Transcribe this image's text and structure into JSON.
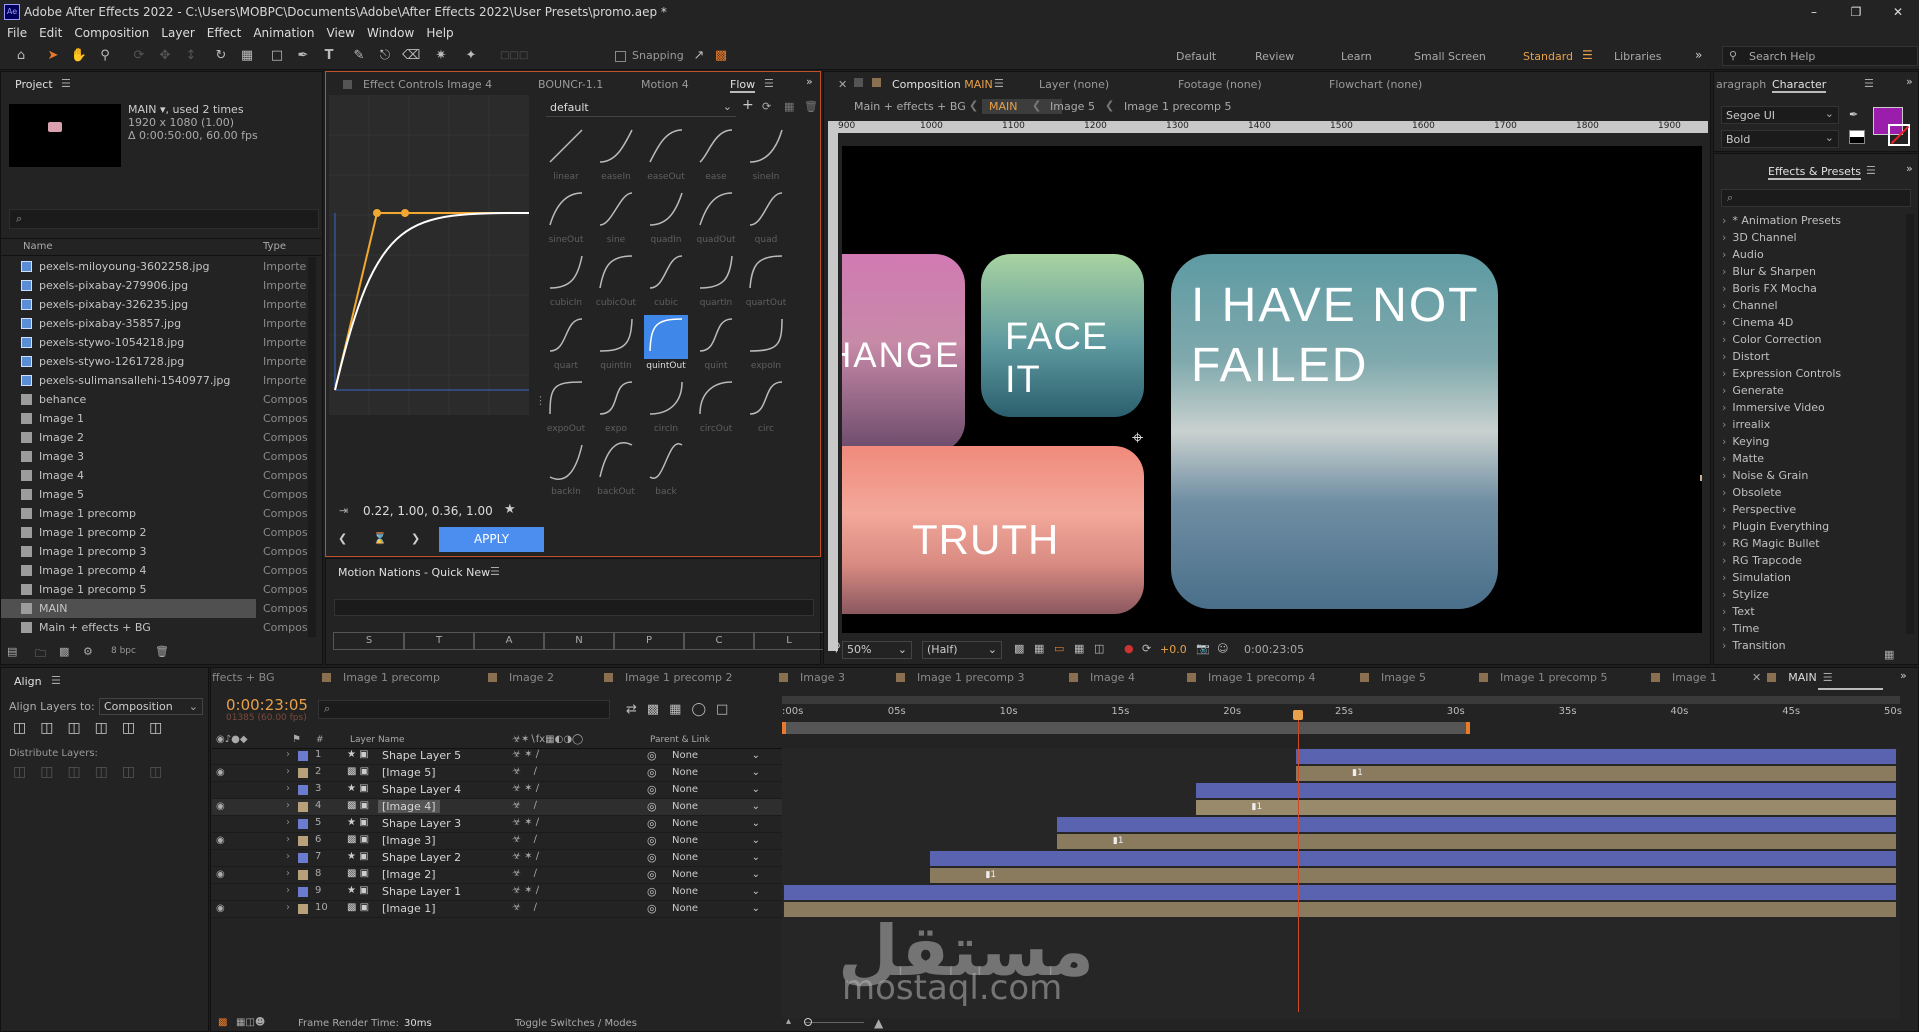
{
  "app": {
    "title": "Adobe After Effects 2022 - C:\\Users\\MOBPC\\Documents\\Adobe\\After Effects 2022\\User Presets\\promo.aep *",
    "logo": "Ae"
  },
  "menu": [
    "File",
    "Edit",
    "Composition",
    "Layer",
    "Effect",
    "Animation",
    "View",
    "Window",
    "Help"
  ],
  "toolbar": {
    "snapping_label": "Snapping",
    "workspaces": [
      "Default",
      "Review",
      "Learn",
      "Small Screen",
      "Standard",
      "Libraries"
    ],
    "active_workspace": "Standard",
    "search_help": "Search Help"
  },
  "project": {
    "tab": "Project",
    "comp_name": "MAIN",
    "used": ", used 2 times",
    "res": "1920 x 1080 (1.00)",
    "duration": "Δ 0:00:50:00, 60.00 fps",
    "search_placeholder": "⌕",
    "col_name": "Name",
    "col_type": "Type",
    "items": [
      {
        "name": "pexels-miloyoung-3602258.jpg",
        "type": "Importe",
        "kind": "file"
      },
      {
        "name": "pexels-pixabay-279906.jpg",
        "type": "Importe",
        "kind": "file"
      },
      {
        "name": "pexels-pixabay-326235.jpg",
        "type": "Importe",
        "kind": "file"
      },
      {
        "name": "pexels-pixabay-35857.jpg",
        "type": "Importe",
        "kind": "file"
      },
      {
        "name": "pexels-stywo-1054218.jpg",
        "type": "Importe",
        "kind": "file"
      },
      {
        "name": "pexels-stywo-1261728.jpg",
        "type": "Importe",
        "kind": "file"
      },
      {
        "name": "pexels-sulimansallehi-1540977.jpg",
        "type": "Importe",
        "kind": "file"
      },
      {
        "name": "behance",
        "type": "Compos",
        "kind": "comp"
      },
      {
        "name": "Image 1",
        "type": "Compos",
        "kind": "comp"
      },
      {
        "name": "Image 2",
        "type": "Compos",
        "kind": "comp"
      },
      {
        "name": "Image 3",
        "type": "Compos",
        "kind": "comp"
      },
      {
        "name": "Image 4",
        "type": "Compos",
        "kind": "comp"
      },
      {
        "name": "Image 5",
        "type": "Compos",
        "kind": "comp"
      },
      {
        "name": "Image 1 precomp",
        "type": "Compos",
        "kind": "comp"
      },
      {
        "name": "Image 1 precomp 2",
        "type": "Compos",
        "kind": "comp"
      },
      {
        "name": "Image 1 precomp 3",
        "type": "Compos",
        "kind": "comp"
      },
      {
        "name": "Image 1 precomp 4",
        "type": "Compos",
        "kind": "comp"
      },
      {
        "name": "Image 1 precomp 5",
        "type": "Compos",
        "kind": "comp"
      },
      {
        "name": "MAIN",
        "type": "Compos",
        "kind": "comp",
        "selected": true
      },
      {
        "name": "Main + effects + BG",
        "type": "Compos",
        "kind": "comp"
      }
    ],
    "bpc": "8 bpc"
  },
  "effect_controls": {
    "tabs": [
      "Effect Controls Image 4",
      "BOUNCr-1.1",
      "Motion 4",
      "Flow"
    ],
    "active_tab": "Flow",
    "preset_dropdown": "default",
    "bezier_values": "0.22, 1.00, 0.36, 1.00",
    "apply_label": "APPLY",
    "presets": [
      "linear",
      "easeIn",
      "easeOut",
      "ease",
      "sineIn",
      "sineOut",
      "sine",
      "quadIn",
      "quadOut",
      "quad",
      "cubicIn",
      "cubicOut",
      "cubic",
      "quartIn",
      "quartOut",
      "quart",
      "quintIn",
      "quintOut",
      "quint",
      "expoIn",
      "expoOut",
      "expo",
      "circIn",
      "circOut",
      "circ",
      "backIn",
      "backOut",
      "back"
    ],
    "selected_preset": "quintOut"
  },
  "quick_new": {
    "title": "Motion Nations - Quick New",
    "buttons": [
      "S",
      "T",
      "A",
      "N",
      "P",
      "C",
      "L"
    ]
  },
  "composition": {
    "tabs": [
      "Composition",
      "Layer",
      "Footage",
      "Flowchart"
    ],
    "comp_label": "MAIN",
    "layer_val": "(none)",
    "footage_val": "(none)",
    "flowchart_val": "(none)",
    "breadcrumbs": [
      "Main + effects + BG",
      "MAIN",
      "Image 5",
      "Image 1 precomp 5"
    ],
    "ruler": [
      "900",
      "1000",
      "1100",
      "1200",
      "1300",
      "1400",
      "1500",
      "1600",
      "1700",
      "1800",
      "1900"
    ],
    "cards": [
      "HANGE",
      "FACE IT",
      "TRUTH",
      "I HAVE NOT\nFAILED"
    ],
    "zoom": "50%",
    "resolution": "(Half)",
    "exposure": "+0.0",
    "timecode": "0:00:23:05"
  },
  "character": {
    "tabs": [
      "aragraph",
      "Character"
    ],
    "font": "Segoe UI",
    "style": "Bold",
    "fill_color": "#9b1dab"
  },
  "effects_presets": {
    "tab": "Effects & Presets",
    "search_placeholder": "⌕",
    "categories": [
      "* Animation Presets",
      "3D Channel",
      "Audio",
      "Blur & Sharpen",
      "Boris FX Mocha",
      "Channel",
      "Cinema 4D",
      "Color Correction",
      "Distort",
      "Expression Controls",
      "Generate",
      "Immersive Video",
      "irrealix",
      "Keying",
      "Matte",
      "Noise & Grain",
      "Obsolete",
      "Perspective",
      "Plugin Everything",
      "RG Magic Bullet",
      "RG Trapcode",
      "Simulation",
      "Stylize",
      "Text",
      "Time",
      "Transition"
    ]
  },
  "align": {
    "tab": "Align",
    "align_to_label": "Align Layers to:",
    "align_to_value": "Composition",
    "distribute_label": "Distribute Layers:"
  },
  "timeline": {
    "tabs": [
      "ffects + BG",
      "Image 1 precomp",
      "Image 2",
      "Image 1 precomp 2",
      "Image 3",
      "Image 1 precomp 3",
      "Image 4",
      "Image 1 precomp 4",
      "Image 5",
      "Image 1 precomp 5",
      "Image 1",
      "MAIN"
    ],
    "active_tab": "MAIN",
    "timecode": "0:00:23:05",
    "frame": "01385 (60.00 fps)",
    "search_placeholder": "⌕",
    "col_layer_name": "Layer Name",
    "col_parent": "Parent & Link",
    "ruler_labels": [
      ":00s",
      "05s",
      "10s",
      "15s",
      "20s",
      "25s",
      "30s",
      "35s",
      "40s",
      "45s",
      "50s"
    ],
    "layers": [
      {
        "num": "1",
        "name": "Shape Layer 5",
        "kind": "shape",
        "eye": false,
        "color": "#6b7bd0",
        "parent": "None",
        "start_s": 23.0
      },
      {
        "num": "2",
        "name": "[Image 5]",
        "kind": "image",
        "eye": true,
        "color": "#b8a07a",
        "parent": "None",
        "start_s": 23.0
      },
      {
        "num": "3",
        "name": "Shape Layer 4",
        "kind": "shape",
        "eye": false,
        "color": "#6b7bd0",
        "parent": "None",
        "start_s": 18.5
      },
      {
        "num": "4",
        "name": "[Image 4]",
        "kind": "image",
        "eye": true,
        "color": "#b8a07a",
        "parent": "None",
        "start_s": 18.5,
        "selected": true
      },
      {
        "num": "5",
        "name": "Shape Layer 3",
        "kind": "shape",
        "eye": false,
        "color": "#6b7bd0",
        "parent": "None",
        "start_s": 12.3
      },
      {
        "num": "6",
        "name": "[Image 3]",
        "kind": "image",
        "eye": true,
        "color": "#b8a07a",
        "parent": "None",
        "start_s": 12.3
      },
      {
        "num": "7",
        "name": "Shape Layer 2",
        "kind": "shape",
        "eye": false,
        "color": "#6b7bd0",
        "parent": "None",
        "start_s": 6.6
      },
      {
        "num": "8",
        "name": "[Image 2]",
        "kind": "image",
        "eye": true,
        "color": "#b8a07a",
        "parent": "None",
        "start_s": 6.6
      },
      {
        "num": "9",
        "name": "Shape Layer 1",
        "kind": "shape",
        "eye": false,
        "color": "#6b7bd0",
        "parent": "None",
        "start_s": 0.1
      },
      {
        "num": "10",
        "name": "[Image 1]",
        "kind": "image",
        "eye": true,
        "color": "#b8a07a",
        "parent": "None",
        "start_s": 0.1
      }
    ],
    "frame_render_label": "Frame Render Time:",
    "frame_render_value": "30ms",
    "toggle_label": "Toggle Switches / Modes"
  },
  "watermark": {
    "arabic": "مستقل",
    "latin": "mostaql.com"
  }
}
